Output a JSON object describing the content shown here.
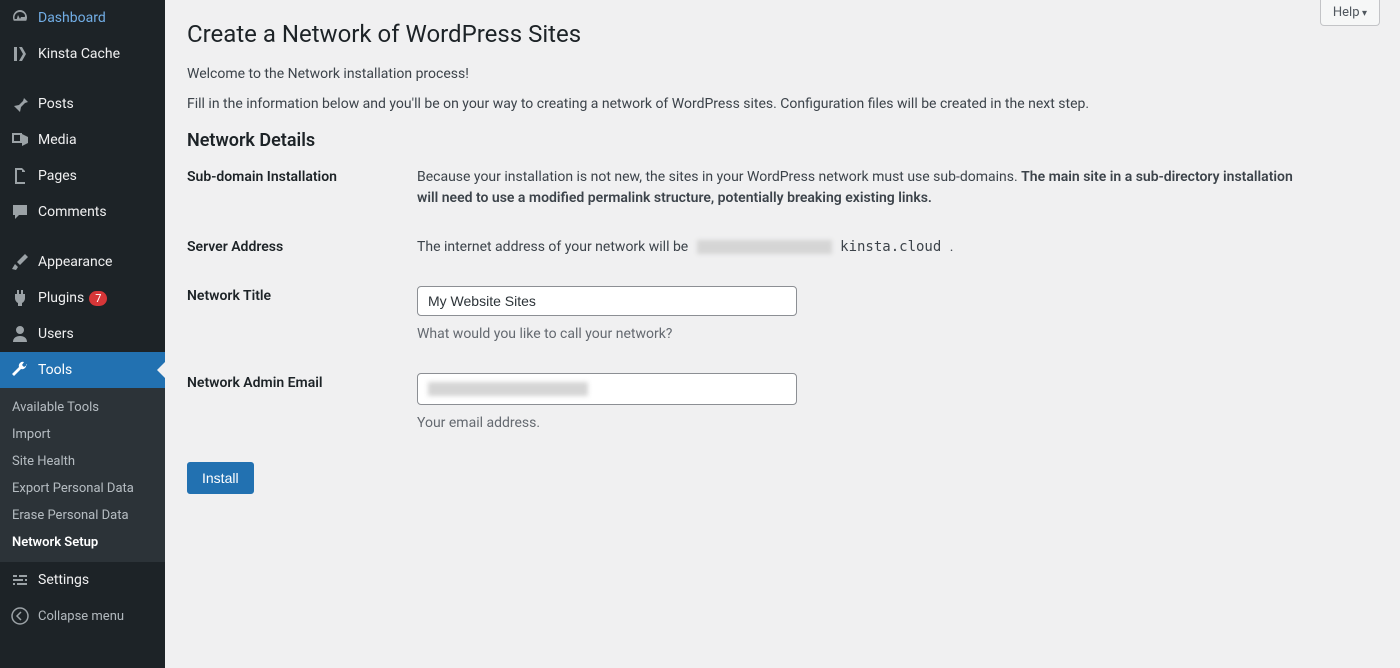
{
  "sidebar": {
    "items": [
      {
        "label": "Dashboard",
        "icon": "dashboard"
      },
      {
        "label": "Kinsta Cache",
        "icon": "kinsta"
      },
      {
        "label": "Posts",
        "icon": "pin"
      },
      {
        "label": "Media",
        "icon": "media"
      },
      {
        "label": "Pages",
        "icon": "page"
      },
      {
        "label": "Comments",
        "icon": "comment"
      },
      {
        "label": "Appearance",
        "icon": "brush"
      },
      {
        "label": "Plugins",
        "icon": "plug",
        "badge": "7"
      },
      {
        "label": "Users",
        "icon": "user"
      },
      {
        "label": "Tools",
        "icon": "wrench",
        "active": true
      },
      {
        "label": "Settings",
        "icon": "sliders"
      }
    ],
    "submenu": [
      {
        "label": "Available Tools"
      },
      {
        "label": "Import"
      },
      {
        "label": "Site Health"
      },
      {
        "label": "Export Personal Data"
      },
      {
        "label": "Erase Personal Data"
      },
      {
        "label": "Network Setup",
        "current": true
      }
    ],
    "collapse": "Collapse menu"
  },
  "help": "Help",
  "page": {
    "title": "Create a Network of WordPress Sites",
    "welcome": "Welcome to the Network installation process!",
    "intro": "Fill in the information below and you'll be on your way to creating a network of WordPress sites. Configuration files will be created in the next step.",
    "section": "Network Details",
    "rows": {
      "subdomain": {
        "label": "Sub-domain Installation",
        "text": "Because your installation is not new, the sites in your WordPress network must use sub-domains. ",
        "bold": "The main site in a sub-directory installation will need to use a modified permalink structure, potentially breaking existing links."
      },
      "server": {
        "label": "Server Address",
        "text": "The internet address of your network will be ",
        "host_suffix": "kinsta.cloud",
        "period": "."
      },
      "title": {
        "label": "Network Title",
        "value": "My Website Sites",
        "help": "What would you like to call your network?"
      },
      "email": {
        "label": "Network Admin Email",
        "help": "Your email address."
      }
    },
    "install": "Install"
  }
}
